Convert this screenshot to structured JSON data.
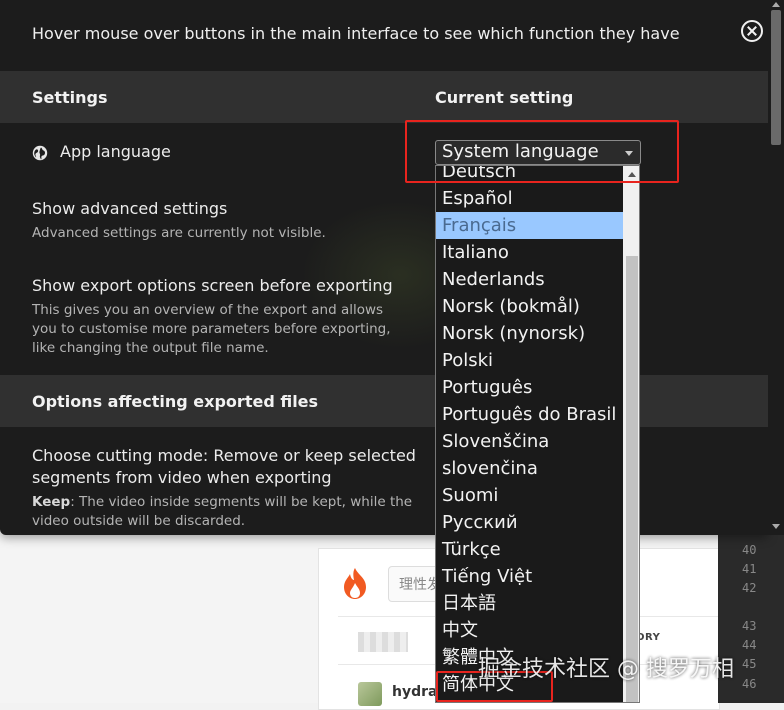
{
  "dialog": {
    "hint": "Hover mouse over buttons in the main interface to see which function they have",
    "close_icon": "close-circle-icon"
  },
  "settings_header": {
    "settings_label": "Settings",
    "current_setting_label": "Current setting"
  },
  "rows": {
    "app_language": {
      "label": "App language",
      "icon": "globe-icon"
    },
    "advanced": {
      "label": "Show advanced settings",
      "description": "Advanced settings are currently not visible."
    },
    "export_screen": {
      "label": "Show export options screen before exporting",
      "description": "This gives you an overview of the export and allows you to customise more parameters before exporting, like changing the output file name."
    }
  },
  "export_section": {
    "title": "Options affecting exported files",
    "cutting_mode": {
      "label_line1": "Choose cutting mode: Remove or keep selected",
      "label_line2": "segments from video when exporting",
      "desc_bold": "Keep",
      "desc_line1": ": The video inside segments will be kept, while the",
      "desc_line2": "video outside will be discarded."
    }
  },
  "language_select": {
    "value": "System language",
    "options": [
      "Deutsch",
      "Español",
      "Français",
      "Italiano",
      "Nederlands",
      "Norsk (bokmål)",
      "Norsk (nynorsk)",
      "Polski",
      "Português",
      "Português do Brasil",
      "Slovenščina",
      "slovenčina",
      "Suomi",
      "Русский",
      "Türkçe",
      "Tiếng Việt",
      "日本語",
      "中文",
      "繁體中文",
      "简体中文"
    ],
    "highlighted": "Français"
  },
  "background_page": {
    "search_placeholder": "理性发",
    "username": "hydra",
    "story_label": "ORY",
    "line_numbers": [
      "40",
      "41",
      "42",
      "43",
      "44",
      "45",
      "46"
    ]
  },
  "watermark": "掘金技术社区 @ 搜罗万相",
  "colors": {
    "dialog_bg": "#1c1c1c",
    "section_bg": "#303030",
    "highlight_bg": "#99c8ff",
    "annotation_red": "#e8241e"
  }
}
